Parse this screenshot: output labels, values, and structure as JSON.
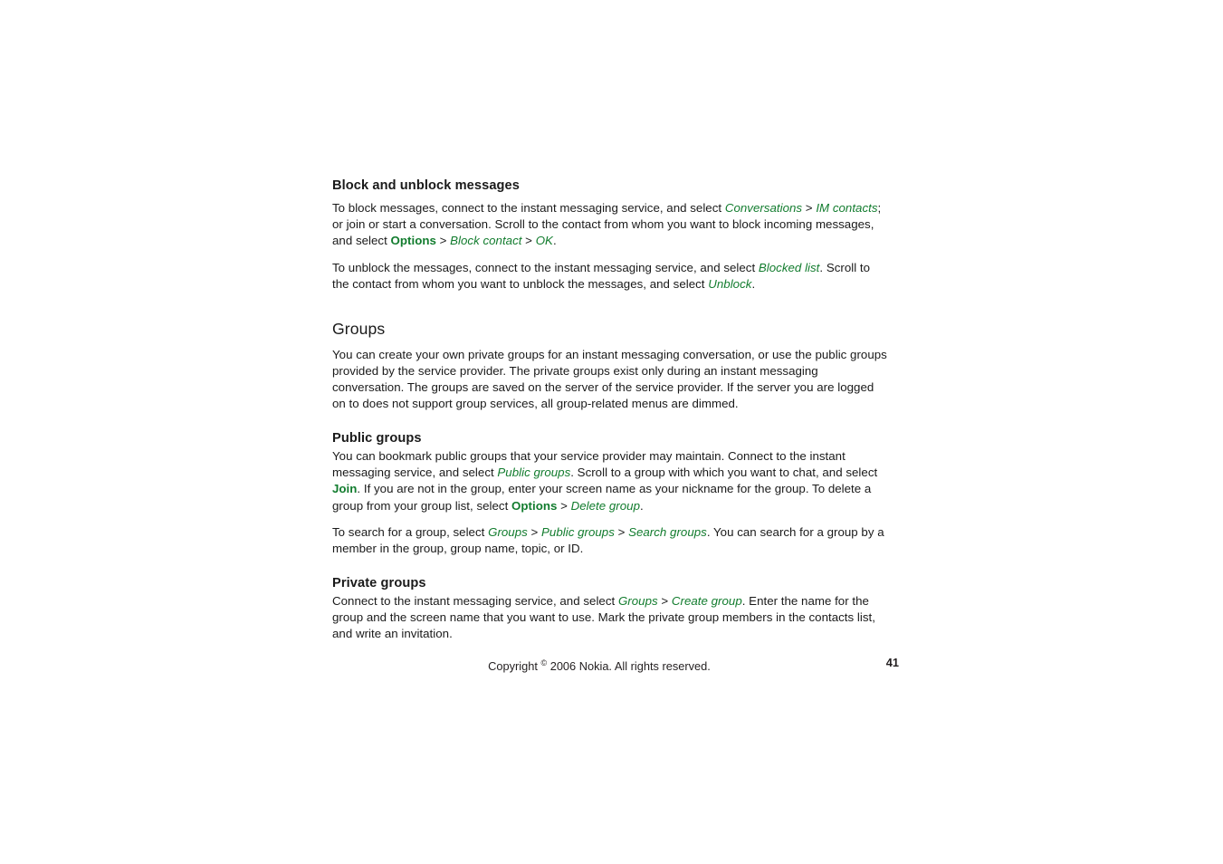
{
  "document": {
    "page_number": "41",
    "footer_copyright_prefix": "Copyright ",
    "footer_copyright_symbol": "©",
    "footer_copyright_suffix": " 2006 Nokia. All rights reserved.",
    "accent_color": "#127c2e",
    "text_color": "#1a1a1a"
  },
  "sections": [
    {
      "heading": "Block and unblock messages",
      "heading_level": "h1",
      "paragraphs": [
        {
          "runs": [
            {
              "t": "To block messages, connect to the instant messaging service, and select ",
              "s": "plain"
            },
            {
              "t": "Conversations",
              "s": "menu-italic"
            },
            {
              "t": " > ",
              "s": "separator"
            },
            {
              "t": "IM contacts",
              "s": "menu-italic"
            },
            {
              "t": "; or join or start a conversation. Scroll to the contact from whom you want to block incoming messages, and select ",
              "s": "plain"
            },
            {
              "t": "Options",
              "s": "menu-bold"
            },
            {
              "t": " > ",
              "s": "separator"
            },
            {
              "t": "Block contact",
              "s": "menu-italic"
            },
            {
              "t": " > ",
              "s": "separator"
            },
            {
              "t": "OK",
              "s": "menu-italic"
            },
            {
              "t": ".",
              "s": "plain"
            }
          ]
        },
        {
          "runs": [
            {
              "t": "To unblock the messages, connect to the instant messaging service, and select ",
              "s": "plain"
            },
            {
              "t": "Blocked list",
              "s": "menu-italic"
            },
            {
              "t": ". Scroll to the contact from whom you want to unblock the messages, and select ",
              "s": "plain"
            },
            {
              "t": "Unblock",
              "s": "menu-italic"
            },
            {
              "t": ".",
              "s": "plain"
            }
          ]
        }
      ]
    },
    {
      "heading": "Groups",
      "heading_level": "h2",
      "paragraphs": [
        {
          "runs": [
            {
              "t": "You can create your own private groups for an instant messaging conversation, or use the public groups provided by the service provider. The private groups exist only during an instant messaging conversation. The groups are saved on the server of the service provider. If the server you are logged on to does not support group services, all group-related menus are dimmed.",
              "s": "plain"
            }
          ]
        }
      ]
    },
    {
      "heading": "Public groups",
      "heading_level": "h3",
      "paragraphs": [
        {
          "runs": [
            {
              "t": "You can bookmark public groups that your service provider may maintain. Connect to the instant messaging service, and select ",
              "s": "plain"
            },
            {
              "t": "Public groups",
              "s": "menu-italic"
            },
            {
              "t": ". Scroll to a group with which you want to chat, and select ",
              "s": "plain"
            },
            {
              "t": "Join",
              "s": "menu-bold"
            },
            {
              "t": ". If you are not in the group, enter your screen name as your nickname for the group. To delete a group from your group list, select ",
              "s": "plain"
            },
            {
              "t": "Options",
              "s": "menu-bold"
            },
            {
              "t": " > ",
              "s": "separator"
            },
            {
              "t": "Delete group",
              "s": "menu-italic"
            },
            {
              "t": ".",
              "s": "plain"
            }
          ]
        },
        {
          "runs": [
            {
              "t": "To search for a group, select ",
              "s": "plain"
            },
            {
              "t": "Groups",
              "s": "menu-italic"
            },
            {
              "t": " > ",
              "s": "separator"
            },
            {
              "t": "Public groups",
              "s": "menu-italic"
            },
            {
              "t": " > ",
              "s": "separator"
            },
            {
              "t": "Search groups",
              "s": "menu-italic"
            },
            {
              "t": ". You can search for a group by a member in the group, group name, topic, or ID.",
              "s": "plain"
            }
          ]
        }
      ]
    },
    {
      "heading": "Private groups",
      "heading_level": "h3",
      "paragraphs": [
        {
          "runs": [
            {
              "t": "Connect to the instant messaging service, and select ",
              "s": "plain"
            },
            {
              "t": "Groups",
              "s": "menu-italic"
            },
            {
              "t": " > ",
              "s": "separator"
            },
            {
              "t": "Create group",
              "s": "menu-italic"
            },
            {
              "t": ". Enter the name for the group and the screen name that you want to use. Mark the private group members in the contacts list, and write an invitation.",
              "s": "plain"
            }
          ]
        }
      ]
    }
  ]
}
